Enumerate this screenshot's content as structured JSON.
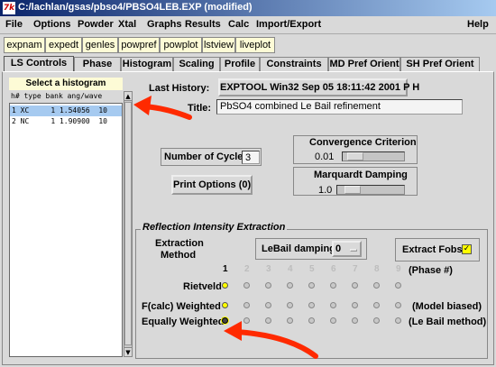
{
  "window": {
    "title": "C:/lachlan/gsas/pbso4/PBSO4LEB.EXP (modified)",
    "app_icon": "7k"
  },
  "menu": {
    "items": [
      "File",
      "Options",
      "Powder",
      "Xtal",
      "Graphs",
      "Results",
      "Calc",
      "Import/Export"
    ],
    "help": "Help"
  },
  "toolbar": [
    "expnam",
    "expedt",
    "genles",
    "powpref",
    "powplot",
    "lstview",
    "liveplot"
  ],
  "tabs": [
    "LS Controls",
    "Phase",
    "Histogram",
    "Scaling",
    "Profile",
    "Constraints",
    "MD Pref Orient",
    "SH Pref Orient"
  ],
  "histogram_panel": {
    "header": "Select a histogram",
    "columns": "h# type bank ang/wave",
    "rows": [
      {
        "text": "1 XC     1 1.54056  10",
        "selected": true
      },
      {
        "text": "2 NC     1 1.90900  10",
        "selected": false
      }
    ]
  },
  "last_history": {
    "label": "Last History:",
    "value": "EXPTOOL  Win32  Sep 05 18:11:42 2001 P  H"
  },
  "title_field": {
    "label": "Title:",
    "value": "PbSO4 combined Le Bail refinement"
  },
  "cycles": {
    "label": "Number of Cycles",
    "value": "3"
  },
  "convergence": {
    "label": "Convergence Criterion",
    "value": "0.01",
    "level": 0.1
  },
  "marquardt": {
    "label": "Marquardt Damping",
    "value": "1.0",
    "level": 0.15
  },
  "print_options": "Print Options (0)",
  "extraction": {
    "group_title": "Reflection Intensity Extraction",
    "method_label_1": "Extraction",
    "method_label_2": "Method",
    "lebail_label": "LeBail damping",
    "lebail_value": "0",
    "extract_fobs_label": "Extract Fobs",
    "extract_fobs_checked": true,
    "phase_numbers": [
      "1",
      "2",
      "3",
      "4",
      "5",
      "6",
      "7",
      "8",
      "9"
    ],
    "phase_hint": "(Phase #)",
    "rows": [
      {
        "label": "Rietveld",
        "note": ""
      },
      {
        "label": "F(calc) Weighted",
        "note": "(Model biased)"
      },
      {
        "label": "Equally Weighted",
        "note": "(Le Bail method)"
      }
    ],
    "selected_row": 2
  },
  "colors": {
    "title_gradient_start": "#0a246a",
    "title_gradient_end": "#a6caf0",
    "toolbar_button": "#fdfbd6",
    "active_radio": "#ffff00",
    "annotation_arrow": "#ff2a00",
    "selection": "#a6caf0"
  }
}
